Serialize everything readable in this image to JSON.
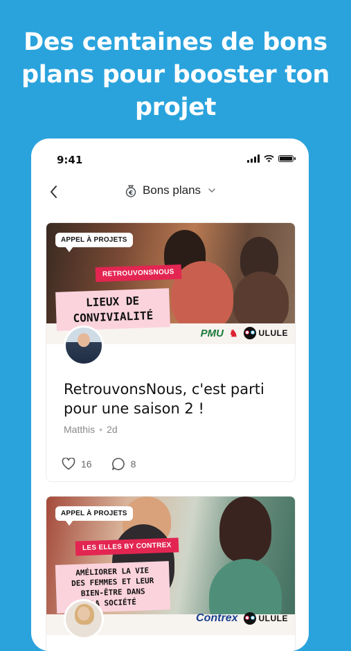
{
  "headline": "Des centaines de bons plans pour booster ton projet",
  "status_bar": {
    "time": "9:41"
  },
  "nav": {
    "title": "Bons plans"
  },
  "posts": [
    {
      "badge": "APPEL À PROJETS",
      "tag": "RETROUVONSNOUS",
      "banner_line1": "LIEUX DE",
      "banner_line2": "CONVIVIALITÉ",
      "partner": "PMU",
      "brand": "ULULE",
      "title": "RetrouvonsNous, c'est parti pour une saison 2 !",
      "author": "Matthis",
      "age": "2d",
      "likes": "16",
      "comments": "8"
    },
    {
      "badge": "APPEL À PROJETS",
      "tag": "LES ELLES BY CONTREX",
      "banner_line1": "AMÉLIORER LA VIE",
      "banner_line2": "DES FEMMES ET LEUR",
      "banner_line3": "BIEN-ÊTRE DANS",
      "banner_line4": "LA SOCIÉTÉ",
      "partner": "Contrex",
      "brand": "ULULE"
    }
  ],
  "colors": {
    "background": "#2aa3dd",
    "tag_red": "#e32552",
    "tag_pink": "#fbd3dd"
  }
}
